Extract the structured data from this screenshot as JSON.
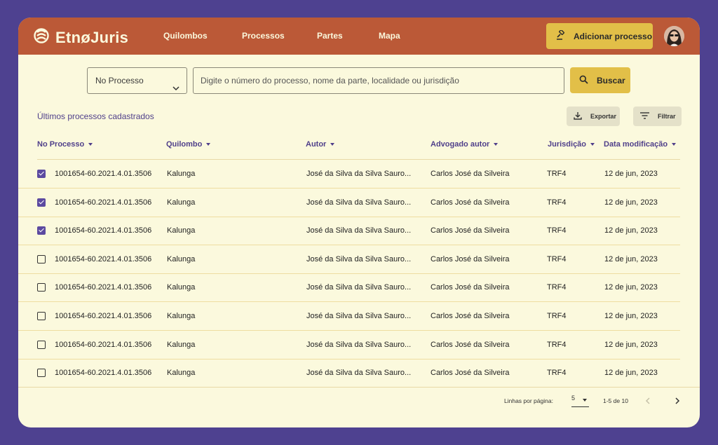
{
  "header": {
    "brand": "EtnøJuris",
    "nav": [
      {
        "label": "Quilombos"
      },
      {
        "label": "Processos"
      },
      {
        "label": "Partes"
      },
      {
        "label": "Mapa"
      }
    ],
    "add_button": "Adicionar processo"
  },
  "search": {
    "select_value": "No Processo",
    "placeholder": "Digite o número do processo, nome da parte, localidade ou jurisdição",
    "button": "Buscar"
  },
  "list": {
    "subtitle": "Últimos processos cadastrados",
    "export": "Exportar",
    "filter": "Filtrar"
  },
  "table": {
    "columns": [
      "No Processo",
      "Quilombo",
      "Autor",
      "Advogado autor",
      "Jurisdição",
      "Data modificação"
    ],
    "rows": [
      {
        "checked": true,
        "processo": "1001654-60.2021.4.01.3506",
        "quilombo": "Kalunga",
        "autor": "José da Silva da Silva Sauro...",
        "advogado": "Carlos José da Silveira",
        "jurisdicao": "TRF4",
        "data": "12 de jun, 2023"
      },
      {
        "checked": true,
        "processo": "1001654-60.2021.4.01.3506",
        "quilombo": "Kalunga",
        "autor": "José da Silva da Silva Sauro...",
        "advogado": "Carlos José da Silveira",
        "jurisdicao": "TRF4",
        "data": "12 de jun, 2023"
      },
      {
        "checked": true,
        "processo": "1001654-60.2021.4.01.3506",
        "quilombo": "Kalunga",
        "autor": "José da Silva da Silva Sauro...",
        "advogado": "Carlos José da Silveira",
        "jurisdicao": "TRF4",
        "data": "12 de jun, 2023"
      },
      {
        "checked": false,
        "processo": "1001654-60.2021.4.01.3506",
        "quilombo": "Kalunga",
        "autor": "José da Silva da Silva Sauro...",
        "advogado": "Carlos José da Silveira",
        "jurisdicao": "TRF4",
        "data": "12 de jun, 2023"
      },
      {
        "checked": false,
        "processo": "1001654-60.2021.4.01.3506",
        "quilombo": "Kalunga",
        "autor": "José da Silva da Silva Sauro...",
        "advogado": "Carlos José da Silveira",
        "jurisdicao": "TRF4",
        "data": "12 de jun, 2023"
      },
      {
        "checked": false,
        "processo": "1001654-60.2021.4.01.3506",
        "quilombo": "Kalunga",
        "autor": "José da Silva da Silva Sauro...",
        "advogado": "Carlos José da Silveira",
        "jurisdicao": "TRF4",
        "data": "12 de jun, 2023"
      },
      {
        "checked": false,
        "processo": "1001654-60.2021.4.01.3506",
        "quilombo": "Kalunga",
        "autor": "José da Silva da Silva Sauro...",
        "advogado": "Carlos José da Silveira",
        "jurisdicao": "TRF4",
        "data": "12 de jun, 2023"
      },
      {
        "checked": false,
        "processo": "1001654-60.2021.4.01.3506",
        "quilombo": "Kalunga",
        "autor": "José da Silva da Silva Sauro...",
        "advogado": "Carlos José da Silveira",
        "jurisdicao": "TRF4",
        "data": "12 de jun, 2023"
      }
    ]
  },
  "pagination": {
    "rows_label": "Linhas por página:",
    "rows_value": "5",
    "range": "1-5 de 10"
  },
  "icons": {
    "logo": "logo-icon",
    "add": "gavel-icon",
    "search": "search-icon",
    "export": "download-icon",
    "filter": "filter-icon",
    "prev": "chevron-left-icon",
    "next": "chevron-right-icon"
  },
  "colors": {
    "page_bg": "#4e4190",
    "header": "#bb5937",
    "surface": "#fbf9dd",
    "accent": "#e2bf48",
    "text_accent": "#4f3f8a",
    "checkbox": "#5c4aa0"
  }
}
